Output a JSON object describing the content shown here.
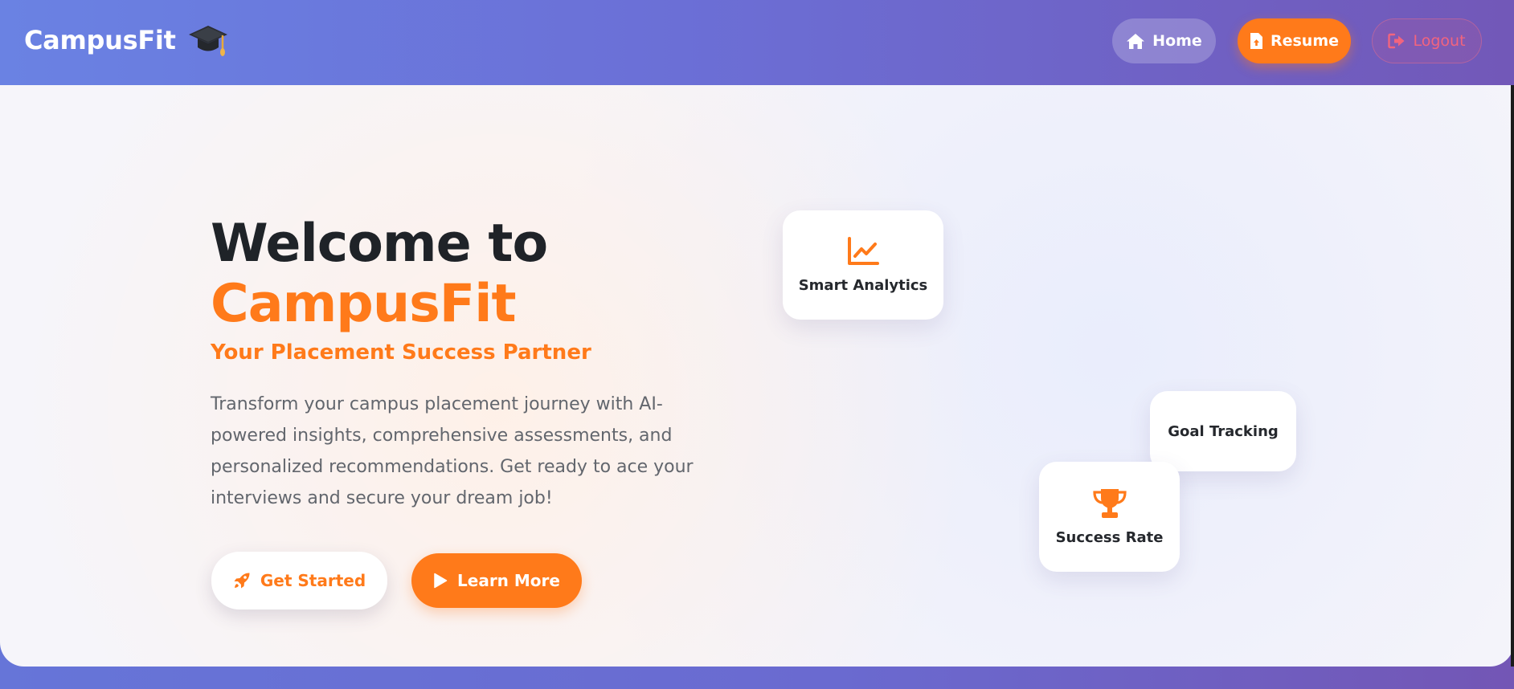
{
  "app": {
    "brand_name": "CampusFit",
    "brand_icon": "graduation-cap-icon",
    "colors": {
      "accent": "#ff7a1a",
      "header_gradient_start": "#6a82e3",
      "header_gradient_end": "#7258b8",
      "logout_text": "#f2647e"
    }
  },
  "nav": {
    "home": {
      "label": "Home",
      "icon": "home-icon"
    },
    "resume": {
      "label": "Resume",
      "icon": "file-upload-icon"
    },
    "logout": {
      "label": "Logout",
      "icon": "sign-out-icon"
    }
  },
  "hero": {
    "title_line1": "Welcome to",
    "title_line2": "CampusFit",
    "subtitle": "Your Placement Success Partner",
    "description": "Transform your campus placement journey with AI-powered insights, comprehensive assessments, and personalized recommendations. Get ready to ace your interviews and secure your dream job!",
    "get_started": {
      "label": "Get Started",
      "icon": "rocket-icon"
    },
    "learn_more": {
      "label": "Learn More",
      "icon": "play-icon"
    }
  },
  "features": {
    "analytics": {
      "label": "Smart Analytics",
      "icon": "line-chart-icon"
    },
    "goal": {
      "label": "Goal Tracking"
    },
    "success": {
      "label": "Success Rate",
      "icon": "trophy-icon"
    }
  }
}
